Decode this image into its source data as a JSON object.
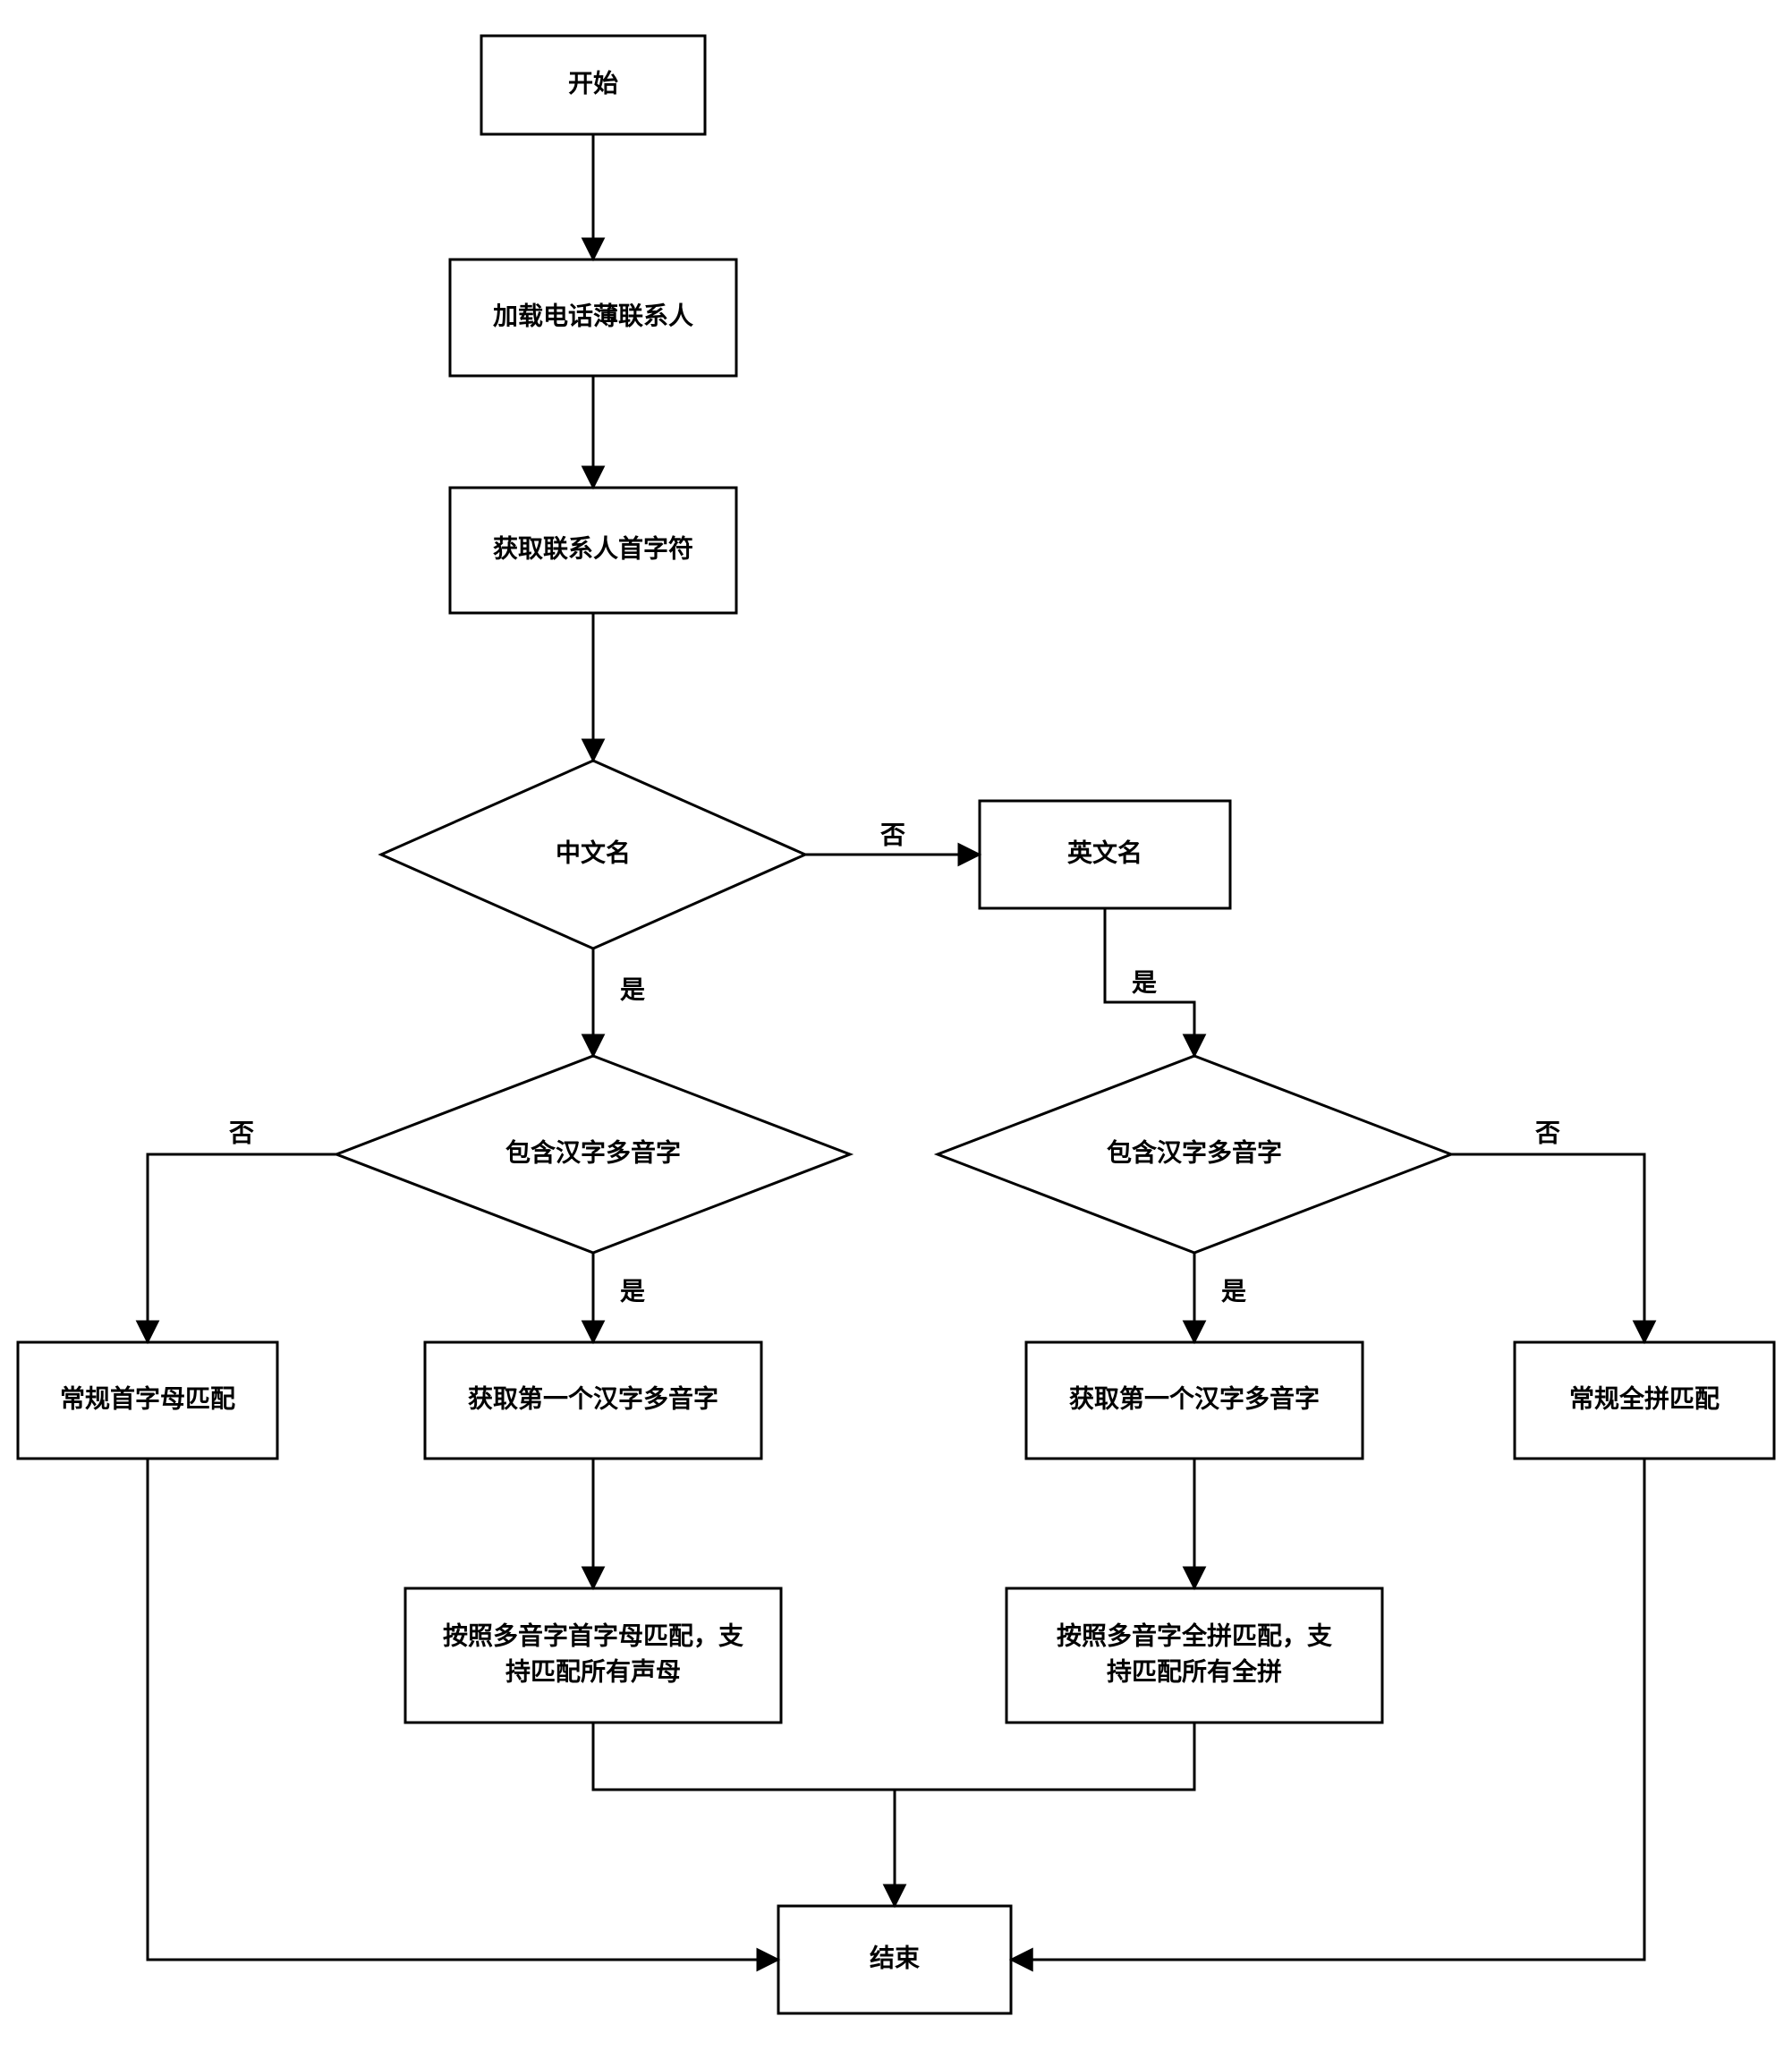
{
  "chart_data": {
    "type": "flowchart",
    "nodes": [
      {
        "id": "start",
        "kind": "process",
        "label": "开始"
      },
      {
        "id": "load",
        "kind": "process",
        "label": "加载电话薄联系人"
      },
      {
        "id": "getfirst",
        "kind": "process",
        "label": "获取联系人首字符"
      },
      {
        "id": "cn_name",
        "kind": "decision",
        "label": "中文名"
      },
      {
        "id": "en_name",
        "kind": "process",
        "label": "英文名"
      },
      {
        "id": "poly_left",
        "kind": "decision",
        "label": "包含汉字多音字"
      },
      {
        "id": "poly_right",
        "kind": "decision",
        "label": "包含汉字多音字"
      },
      {
        "id": "reg_initial",
        "kind": "process",
        "label": "常规首字母匹配"
      },
      {
        "id": "get_poly_left",
        "kind": "process",
        "label": "获取第一个汉字多音字"
      },
      {
        "id": "get_poly_right",
        "kind": "process",
        "label": "获取第一个汉字多音字"
      },
      {
        "id": "reg_full",
        "kind": "process",
        "label": "常规全拼匹配"
      },
      {
        "id": "match_initial",
        "kind": "process",
        "lines": [
          "按照多音字首字母匹配，支",
          "持匹配所有声母"
        ]
      },
      {
        "id": "match_full",
        "kind": "process",
        "lines": [
          "按照多音字全拼匹配，支",
          "持匹配所有全拼"
        ]
      },
      {
        "id": "end",
        "kind": "process",
        "label": "结束"
      }
    ],
    "edges": [
      {
        "from": "start",
        "to": "load"
      },
      {
        "from": "load",
        "to": "getfirst"
      },
      {
        "from": "getfirst",
        "to": "cn_name"
      },
      {
        "from": "cn_name",
        "to": "en_name",
        "label": "否"
      },
      {
        "from": "cn_name",
        "to": "poly_left",
        "label": "是"
      },
      {
        "from": "en_name",
        "to": "poly_right",
        "label": "是"
      },
      {
        "from": "poly_left",
        "to": "reg_initial",
        "label": "否"
      },
      {
        "from": "poly_left",
        "to": "get_poly_left",
        "label": "是"
      },
      {
        "from": "poly_right",
        "to": "get_poly_right",
        "label": "是"
      },
      {
        "from": "poly_right",
        "to": "reg_full",
        "label": "否"
      },
      {
        "from": "get_poly_left",
        "to": "match_initial"
      },
      {
        "from": "get_poly_right",
        "to": "match_full"
      },
      {
        "from": "match_initial",
        "to": "end"
      },
      {
        "from": "match_full",
        "to": "end"
      },
      {
        "from": "reg_initial",
        "to": "end"
      },
      {
        "from": "reg_full",
        "to": "end"
      }
    ]
  },
  "labels": {
    "start": "开始",
    "load": "加载电话薄联系人",
    "getfirst": "获取联系人首字符",
    "cn_name": "中文名",
    "en_name": "英文名",
    "poly_left": "包含汉字多音字",
    "poly_right": "包含汉字多音字",
    "reg_initial": "常规首字母匹配",
    "get_poly_left": "获取第一个汉字多音字",
    "get_poly_right": "获取第一个汉字多音字",
    "reg_full": "常规全拼匹配",
    "match_initial_l1": "按照多音字首字母匹配，支",
    "match_initial_l2": "持匹配所有声母",
    "match_full_l1": "按照多音字全拼匹配，支",
    "match_full_l2": "持匹配所有全拼",
    "end": "结束",
    "yes": "是",
    "no": "否"
  }
}
